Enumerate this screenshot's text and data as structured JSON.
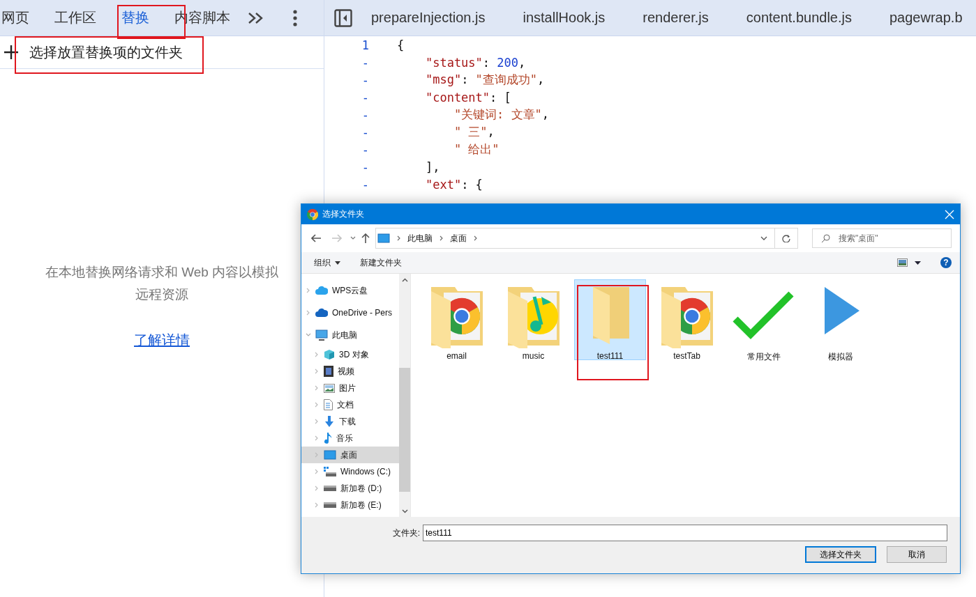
{
  "left_panel": {
    "tabs": [
      {
        "label": "网页",
        "selected": false
      },
      {
        "label": "工作区",
        "selected": false
      },
      {
        "label": "替换",
        "selected": true
      },
      {
        "label": "内容脚本",
        "selected": false
      }
    ],
    "more_tabs": true,
    "menu": true,
    "add_folder": {
      "label": "选择放置替换项的文件夹"
    },
    "empty_message": "在本地替换网络请求和 Web 内容以模拟远程资源",
    "learn_more_link": "了解详情"
  },
  "editor": {
    "sidebar_toggle": true,
    "tabs": [
      {
        "label": "prepareInjection.js",
        "selected": false
      },
      {
        "label": "installHook.js",
        "selected": false
      },
      {
        "label": "renderer.js",
        "selected": false
      },
      {
        "label": "content.bundle.js",
        "selected": false
      },
      {
        "label": "pagewrap.b",
        "selected": false
      }
    ],
    "lines": [
      {
        "gutter": "1",
        "tokens": [
          {
            "kind": "punct",
            "text": "{"
          }
        ]
      },
      {
        "gutter": "-",
        "tokens": [
          {
            "kind": "key",
            "text": "    \"status\""
          },
          {
            "kind": "punct",
            "text": ": "
          },
          {
            "kind": "number",
            "text": "200"
          },
          {
            "kind": "punct",
            "text": ","
          }
        ]
      },
      {
        "gutter": "-",
        "tokens": [
          {
            "kind": "key",
            "text": "    \"msg\""
          },
          {
            "kind": "punct",
            "text": ": "
          },
          {
            "kind": "string",
            "text": "\"查询成功\""
          },
          {
            "kind": "punct",
            "text": ","
          }
        ]
      },
      {
        "gutter": "-",
        "tokens": [
          {
            "kind": "key",
            "text": "    \"content\""
          },
          {
            "kind": "punct",
            "text": ": ["
          }
        ]
      },
      {
        "gutter": "-",
        "tokens": [
          {
            "kind": "string",
            "text": "        \"关键词: 文章\""
          },
          {
            "kind": "punct",
            "text": ","
          }
        ]
      },
      {
        "gutter": "-",
        "tokens": [
          {
            "kind": "string",
            "text": "        \" 三\""
          },
          {
            "kind": "punct",
            "text": ","
          }
        ]
      },
      {
        "gutter": "-",
        "tokens": [
          {
            "kind": "string",
            "text": "        \" 给出\""
          }
        ]
      },
      {
        "gutter": "-",
        "tokens": [
          {
            "kind": "punct",
            "text": "    ],"
          }
        ]
      },
      {
        "gutter": "-",
        "tokens": [
          {
            "kind": "key",
            "text": "    \"ext\""
          },
          {
            "kind": "punct",
            "text": ": {"
          }
        ]
      }
    ]
  },
  "dialog": {
    "title": "选择文件夹",
    "back": {
      "disabled": false
    },
    "forward": {
      "disabled": true
    },
    "breadcrumb": [
      "此电脑",
      "桌面"
    ],
    "search": {
      "placeholder": "搜索\"桌面\""
    },
    "toolbar": {
      "organize": "组织",
      "new_folder": "新建文件夹",
      "help": "?"
    },
    "nav_items": [
      {
        "label": "WPS云盘",
        "kind": "cloud",
        "expanded": false,
        "selected": false
      },
      {
        "label": "OneDrive - Pers",
        "kind": "onedrive",
        "expanded": false,
        "selected": false
      },
      {
        "label": "此电脑",
        "kind": "pc",
        "expanded": true,
        "selected": false,
        "children": [
          {
            "label": "3D 对象",
            "kind": "cube",
            "expanded": false,
            "selected": false
          },
          {
            "label": "视频",
            "kind": "video",
            "expanded": false,
            "selected": false
          },
          {
            "label": "图片",
            "kind": "image",
            "expanded": false,
            "selected": false
          },
          {
            "label": "文档",
            "kind": "doc",
            "expanded": false,
            "selected": false
          },
          {
            "label": "下载",
            "kind": "download",
            "expanded": false,
            "selected": false
          },
          {
            "label": "音乐",
            "kind": "music",
            "expanded": false,
            "selected": false
          },
          {
            "label": "桌面",
            "kind": "desktop",
            "expanded": false,
            "selected": true
          },
          {
            "label": "Windows (C:)",
            "kind": "windrive",
            "expanded": false,
            "selected": false
          },
          {
            "label": "新加卷 (D:)",
            "kind": "drive",
            "expanded": false,
            "selected": false
          },
          {
            "label": "新加卷 (E:)",
            "kind": "drive",
            "expanded": false,
            "selected": false
          }
        ]
      }
    ],
    "files": [
      {
        "label": "email",
        "kind": "chrome-folder",
        "selected": false
      },
      {
        "label": "music",
        "kind": "music-folder",
        "selected": false
      },
      {
        "label": "test111",
        "kind": "folder",
        "selected": true
      },
      {
        "label": "testTab",
        "kind": "chrome-folder",
        "selected": false
      },
      {
        "label": "常用文件",
        "kind": "check",
        "selected": false
      },
      {
        "label": "模拟器",
        "kind": "play",
        "selected": false
      }
    ],
    "folder_label": "文件夹:",
    "folder_value": "test111",
    "buttons": [
      {
        "label": "选择文件夹",
        "kind": "primary"
      },
      {
        "label": "取消",
        "kind": "normal"
      }
    ]
  }
}
